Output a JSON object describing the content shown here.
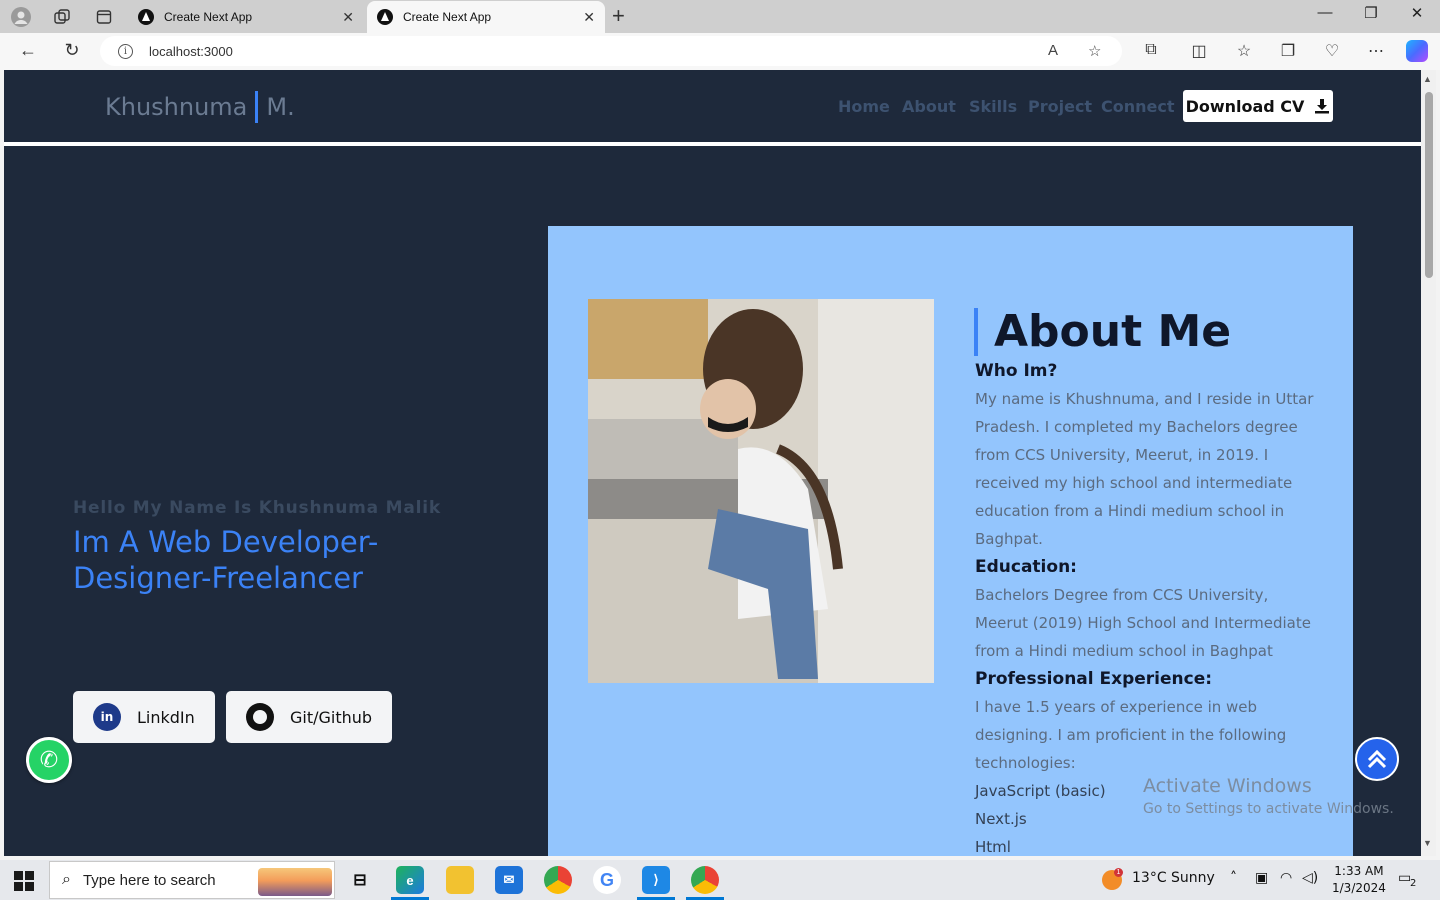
{
  "browser": {
    "tabs": [
      {
        "title": "Create Next App",
        "active": false
      },
      {
        "title": "Create Next App",
        "active": true
      }
    ],
    "url": "localhost:3000",
    "new_tab_symbol": "+",
    "window_controls": {
      "minimize": "—",
      "maximize": "❐",
      "close": "✕"
    }
  },
  "site": {
    "logo_first": "Khushnuma",
    "logo_last": "M.",
    "nav": [
      "Home",
      "About",
      "Skills",
      "Project",
      "Connect"
    ],
    "download_label": "Download CV",
    "hero": {
      "subtitle": "Hello My Name Is Khushnuma Malik",
      "title": "Im A Web Developer-Designer-Freelancer"
    },
    "social": [
      {
        "label": "LinkdIn",
        "icon": "linkedin-icon"
      },
      {
        "label": "Git/Github",
        "icon": "github-icon"
      }
    ],
    "about": {
      "heading": "About Me",
      "who_heading": "Who Im?",
      "who_text": "My name is Khushnuma, and I reside in Uttar Pradesh. I completed my Bachelors degree from CCS University, Meerut, in 2019. I received my high school and intermediate education from a Hindi medium school in Baghpat.",
      "edu_heading": "Education:",
      "edu_text": "Bachelors Degree from CCS University, Meerut (2019) High School and Intermediate from a Hindi medium school in Baghpat",
      "exp_heading": "Professional Experience:",
      "exp_text": "I have 1.5 years of experience in web designing. I am proficient in the following technologies:",
      "technologies": [
        "JavaScript (basic)",
        "Next.js",
        "Html"
      ]
    }
  },
  "watermark": {
    "line1": "Activate Windows",
    "line2": "Go to Settings to activate Windows."
  },
  "taskbar": {
    "search_placeholder": "Type here to search",
    "weather_badge": "1",
    "weather": "13°C  Sunny",
    "time": "1:33 AM",
    "date": "1/3/2024",
    "notification_count": "2"
  },
  "colors": {
    "page_bg": "#1e293b",
    "accent": "#3b82f6",
    "about_bg": "#93c5fd",
    "nav_text": "#3d5270"
  }
}
